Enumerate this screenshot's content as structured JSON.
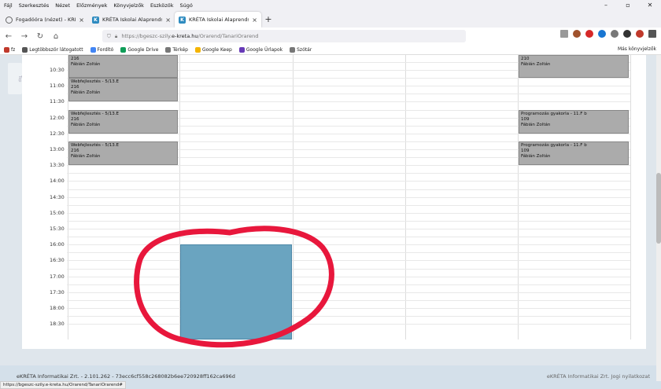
{
  "menu": [
    "Fájl",
    "Szerkesztés",
    "Nézet",
    "Előzmények",
    "Könyvjelzők",
    "Eszközök",
    "Súgó"
  ],
  "tabs": [
    {
      "label": "Fogadóóra (nézet) - KRÉTA Ele...",
      "active": false
    },
    {
      "label": "KRÉTA Iskolai Alaprendszer",
      "active": false
    },
    {
      "label": "KRÉTA Iskolai Alaprendszer",
      "active": true
    }
  ],
  "url": {
    "prefix": "https://bgeszc-szily.",
    "domain": "e-kreta.hu",
    "path": "/Orarend/TanariOrarend"
  },
  "bookmarks": [
    {
      "label": "fz",
      "color": "#c0392b"
    },
    {
      "label": "Legtöbbször látogatott",
      "color": "#555"
    },
    {
      "label": "Fordító",
      "color": "#4285f4"
    },
    {
      "label": "Google Drive",
      "color": "#0f9d58"
    },
    {
      "label": "Térkép",
      "color": "#777"
    },
    {
      "label": "Google Keep",
      "color": "#f4b400"
    },
    {
      "label": "Google Űrlapok",
      "color": "#673ab7"
    },
    {
      "label": "Szótár",
      "color": "#777"
    }
  ],
  "other_bookmarks": "Más könyvjelzők",
  "sidetab": "Top",
  "times": [
    "10:30",
    "11:00",
    "11:30",
    "12:00",
    "12:30",
    "13:00",
    "13:30",
    "14:00",
    "14:30",
    "15:00",
    "15:30",
    "16:00",
    "16:30",
    "17:00",
    "17:30",
    "18:00",
    "18:30"
  ],
  "events": [
    {
      "title": "",
      "room": "216",
      "teacher": "Fábián Zoltán",
      "col": 0,
      "start": "10:00",
      "end": "10:45"
    },
    {
      "title": "Webfejlesztés - 5/13.E",
      "room": "216",
      "teacher": "Fábián Zoltán",
      "col": 0,
      "start": "10:45",
      "end": "11:30"
    },
    {
      "title": "Webfejlesztés - 5/13.E",
      "room": "216",
      "teacher": "Fábián Zoltán",
      "col": 0,
      "start": "11:45",
      "end": "12:30"
    },
    {
      "title": "Webfejlesztés - 5/13.E",
      "room": "216",
      "teacher": "Fábián Zoltán",
      "col": 0,
      "start": "12:45",
      "end": "13:30"
    },
    {
      "title": "",
      "room": "210",
      "teacher": "Fábián Zoltán",
      "col": 4,
      "start": "10:00",
      "end": "10:45"
    },
    {
      "title": "Programozás gyakorla - 11.F b",
      "room": "109",
      "teacher": "Fábián Zoltán",
      "col": 4,
      "start": "11:45",
      "end": "12:30"
    },
    {
      "title": "Programozás gyakorla - 11.F b",
      "room": "109",
      "teacher": "Fábián Zoltán",
      "col": 4,
      "start": "12:45",
      "end": "13:30"
    }
  ],
  "highlight_block": {
    "col": 1,
    "start": "16:00",
    "end": "19:00",
    "color": "#6aa4c0"
  },
  "annotation_color": "#e8173c",
  "footer": {
    "left": "eKRÉTA Informatikai Zrt. - 2.101.262 - 73ecc6cf558c268082b6ee720928ff162ca696d",
    "right": "eKRÉTA Informatikai Zrt. Jogi nyilatkozat"
  },
  "status_url": "https://bgeszc-szily.e-kreta.hu/Orarend/TanariOrarend#"
}
